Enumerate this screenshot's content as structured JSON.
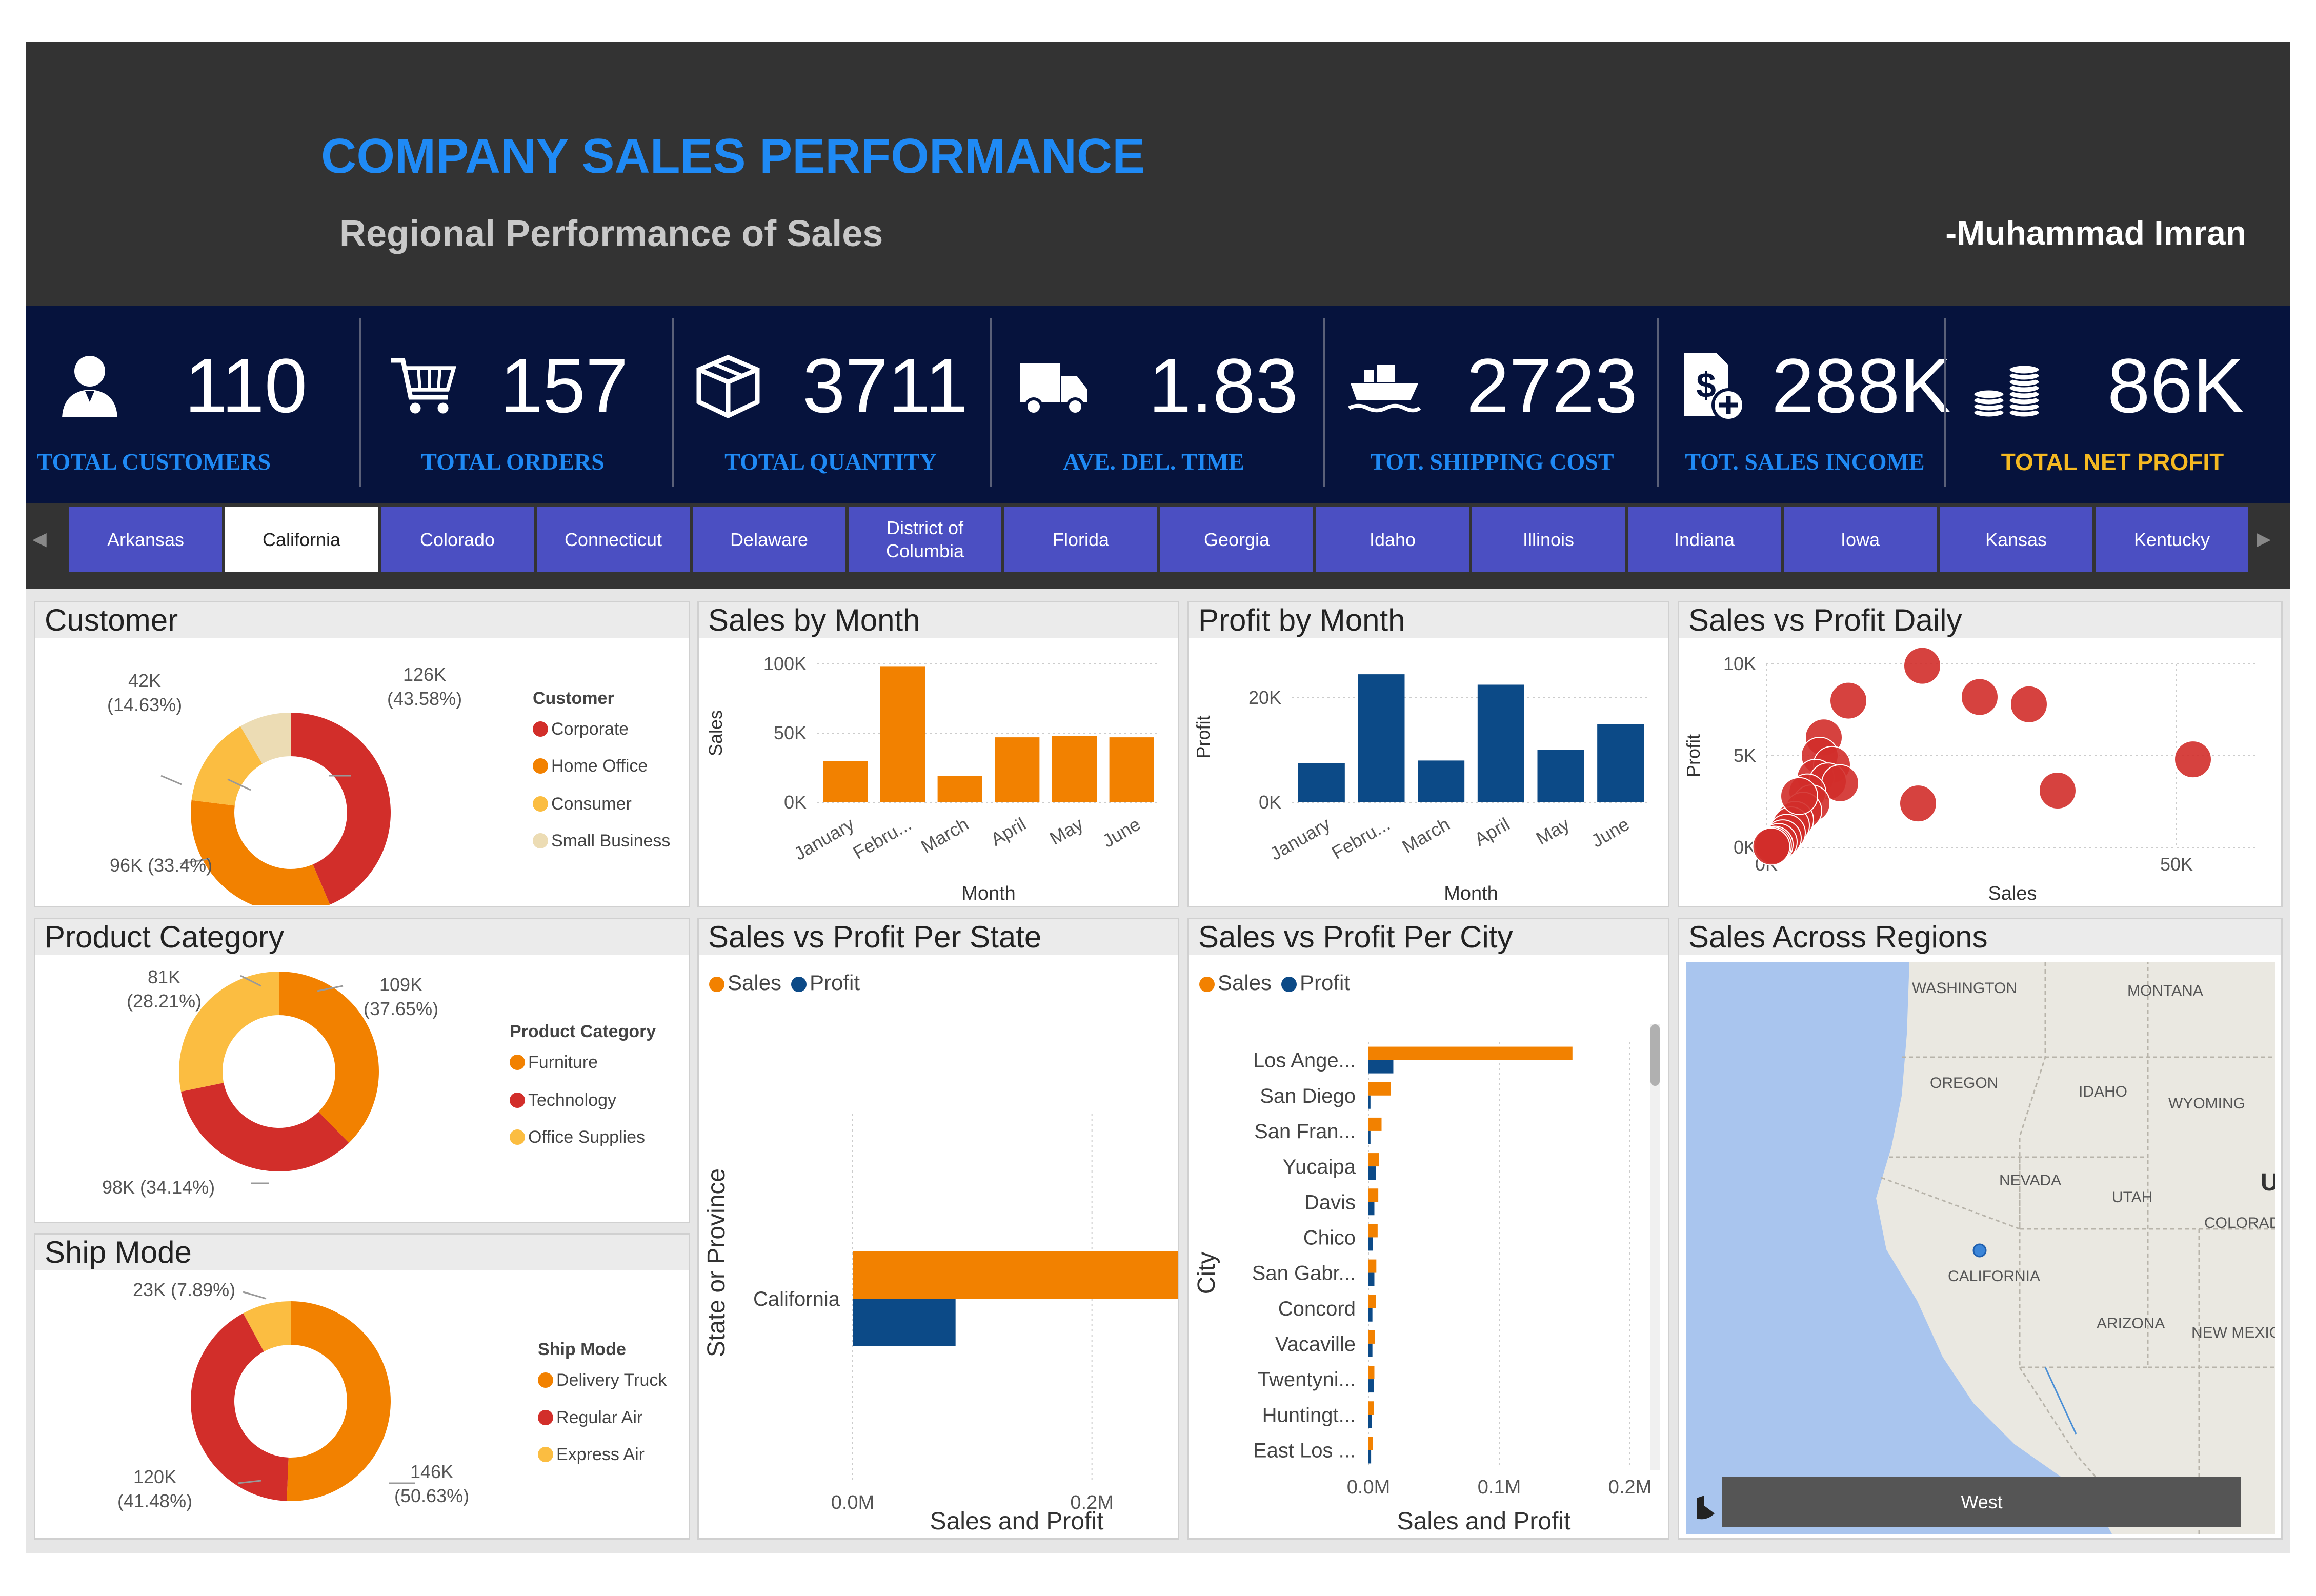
{
  "header": {
    "title": "COMPANY SALES PERFORMANCE",
    "subtitle": "Regional Performance of Sales",
    "author": "-Muhammad Imran"
  },
  "kpis": [
    {
      "value": "110",
      "label": "TOTAL CUSTOMERS",
      "icon": "customer-icon"
    },
    {
      "value": "157",
      "label": "TOTAL ORDERS",
      "icon": "shopping-cart-icon"
    },
    {
      "value": "3711",
      "label": "TOTAL QUANTITY",
      "icon": "box-icon"
    },
    {
      "value": "1.83",
      "label": "AVE. DEL. TIME",
      "icon": "truck-icon"
    },
    {
      "value": "2723",
      "label": "TOT. SHIPPING COST",
      "icon": "ship-icon"
    },
    {
      "value": "288K",
      "label": "TOT. SALES INCOME",
      "icon": "sales-document-icon"
    },
    {
      "value": "86K",
      "label": "TOTAL NET PROFIT",
      "icon": "coins-icon"
    }
  ],
  "colors": {
    "title_blue": "#1f8af5",
    "kpi_bar": "#06133d",
    "slicer_button": "#4b4fc2",
    "profit_label": "#f5b921",
    "orange": "#f28100",
    "red": "#d22e2a",
    "yellow": "#fbbd41",
    "beige": "#ecdcb4",
    "navy": "#0c4a87"
  },
  "slicer": {
    "states": [
      "Arkansas",
      "California",
      "Colorado",
      "Connecticut",
      "Delaware",
      "District of Columbia",
      "Florida",
      "Georgia",
      "Idaho",
      "Illinois",
      "Indiana",
      "Iowa",
      "Kansas",
      "Kentucky"
    ],
    "selected": "California"
  },
  "customer": {
    "title": "Customer",
    "legend_title": "Customer",
    "legend": [
      "Corporate",
      "Home Office",
      "Consumer",
      "Small Business"
    ],
    "labels": {
      "corporate": "126K\n(43.58%)",
      "home_office": "96K (33.4%)",
      "consumer": "42K\n(14.63%)"
    },
    "slices": [
      43.58,
      33.4,
      14.63,
      8.39
    ]
  },
  "product_category": {
    "title": "Product Category",
    "legend_title": "Product Category",
    "legend": [
      "Furniture",
      "Technology",
      "Office Supplies"
    ],
    "labels": {
      "furniture": "109K\n(37.65%)",
      "technology": "98K (34.14%)",
      "office_supplies": "81K\n(28.21%)"
    },
    "slices": [
      37.65,
      34.14,
      28.21
    ]
  },
  "ship_mode": {
    "title": "Ship Mode",
    "legend_title": "Ship Mode",
    "legend": [
      "Delivery Truck",
      "Regular Air",
      "Express Air"
    ],
    "labels": {
      "delivery_truck": "146K\n(50.63%)",
      "regular_air": "120K\n(41.48%)",
      "express_air": "23K (7.89%)"
    },
    "slices": [
      50.63,
      41.48,
      7.89
    ]
  },
  "sales_by_month": {
    "title": "Sales by Month",
    "ylabel": "Sales",
    "xlabel": "Month",
    "yticks": [
      "100K",
      "50K",
      "0K"
    ]
  },
  "profit_by_month": {
    "title": "Profit by Month",
    "ylabel": "Profit",
    "xlabel": "Month",
    "yticks": [
      "20K",
      "0K"
    ]
  },
  "sales_vs_profit_daily": {
    "title": "Sales vs Profit Daily",
    "ylabel": "Profit",
    "xlabel": "Sales",
    "yticks": [
      "10K",
      "5K",
      "0K"
    ],
    "xticks": [
      "0K",
      "50K"
    ]
  },
  "per_state": {
    "title": "Sales vs Profit Per State",
    "legend": [
      "Sales",
      "Profit"
    ],
    "ylabel": "State or Province",
    "xlabel": "Sales and Profit",
    "xticks": [
      "0.0M",
      "0.2M"
    ]
  },
  "per_city": {
    "title": "Sales vs Profit Per City",
    "legend": [
      "Sales",
      "Profit"
    ],
    "ylabel": "City",
    "xlabel": "Sales and Profit",
    "xticks": [
      "0.0M",
      "0.1M",
      "0.2M"
    ]
  },
  "map": {
    "title": "Sales Across Regions",
    "labels": [
      "WASHINGTON",
      "MONTANA",
      "OREGON",
      "IDAHO",
      "WYOMING",
      "NEVADA",
      "UTAH",
      "COLORAD",
      "CALIFORNIA",
      "ARIZONA",
      "NEW MEXIC",
      "U"
    ],
    "region_button": "West"
  },
  "chart_data": [
    {
      "type": "bar",
      "title": "Sales by Month",
      "categories": [
        "January",
        "Febru...",
        "March",
        "April",
        "May",
        "June"
      ],
      "values": [
        30000,
        98000,
        19000,
        47000,
        48000,
        47000
      ],
      "xlabel": "Month",
      "ylabel": "Sales",
      "ylim": [
        0,
        100000
      ],
      "color": "#f28100"
    },
    {
      "type": "bar",
      "title": "Profit by Month",
      "categories": [
        "January",
        "Febru...",
        "March",
        "April",
        "May",
        "June"
      ],
      "values": [
        7500,
        24500,
        8000,
        22500,
        10000,
        15000
      ],
      "xlabel": "Month",
      "ylabel": "Profit",
      "ylim": [
        0,
        25000
      ],
      "color": "#0c4a87"
    },
    {
      "type": "scatter",
      "title": "Sales vs Profit Daily",
      "xlabel": "Sales",
      "ylabel": "Profit",
      "xlim": [
        0,
        60000
      ],
      "ylim": [
        0,
        10000
      ],
      "points": [
        [
          19000,
          9900
        ],
        [
          26000,
          8200
        ],
        [
          32000,
          7800
        ],
        [
          52000,
          4800
        ],
        [
          10000,
          8000
        ],
        [
          7000,
          6000
        ],
        [
          6500,
          5000
        ],
        [
          8000,
          4500
        ],
        [
          6000,
          3800
        ],
        [
          7500,
          3600
        ],
        [
          9000,
          3500
        ],
        [
          5000,
          3000
        ],
        [
          5500,
          2400
        ],
        [
          4500,
          2000
        ],
        [
          3500,
          1500
        ],
        [
          3000,
          1200
        ],
        [
          2500,
          800
        ],
        [
          2000,
          500
        ],
        [
          1500,
          300
        ],
        [
          1000,
          150
        ],
        [
          800,
          100
        ],
        [
          600,
          50
        ],
        [
          18500,
          2400
        ],
        [
          35500,
          3100
        ],
        [
          4000,
          2800
        ]
      ],
      "color": "#d22e2a"
    },
    {
      "type": "bar",
      "title": "Sales vs Profit Per State",
      "orientation": "horizontal",
      "categories": [
        "California"
      ],
      "series": [
        {
          "name": "Sales",
          "values": [
            288000
          ]
        },
        {
          "name": "Profit",
          "values": [
            86000
          ]
        }
      ],
      "xlabel": "Sales and Profit",
      "ylabel": "State or Province",
      "xlim": [
        0,
        300000
      ]
    },
    {
      "type": "bar",
      "title": "Sales vs Profit Per City",
      "orientation": "horizontal",
      "categories": [
        "Los Ange...",
        "San Diego",
        "San Fran...",
        "Yucaipa",
        "Davis",
        "Chico",
        "San Gabr...",
        "Concord",
        "Vacaville",
        "Twentyni...",
        "Huntingt...",
        "East Los ..."
      ],
      "series": [
        {
          "name": "Sales",
          "values": [
            156000,
            17000,
            10000,
            8000,
            7500,
            7000,
            6000,
            5500,
            5000,
            4500,
            4000,
            3500
          ]
        },
        {
          "name": "Profit",
          "values": [
            19000,
            1500,
            1500,
            5500,
            4500,
            3500,
            4500,
            3000,
            3000,
            4000,
            2500,
            2000
          ]
        }
      ],
      "xlabel": "Sales and Profit",
      "ylabel": "City",
      "xlim": [
        0,
        200000
      ]
    }
  ]
}
